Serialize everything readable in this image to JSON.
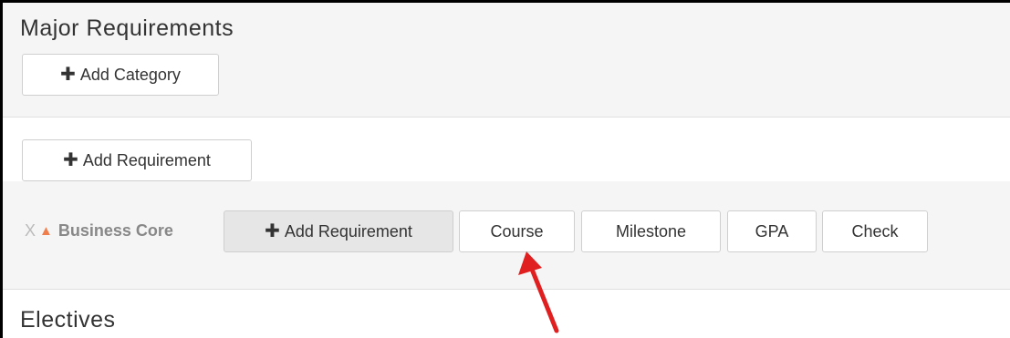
{
  "major": {
    "title": "Major Requirements",
    "add_category_label": "Add Category"
  },
  "requirements": {
    "add_requirement_label": "Add Requirement"
  },
  "business_core": {
    "remove_symbol": "X",
    "name": "Business Core",
    "add_requirement_label": "Add Requirement",
    "types": {
      "course": "Course",
      "milestone": "Milestone",
      "gpa": "GPA",
      "check": "Check"
    }
  },
  "electives": {
    "title": "Electives"
  },
  "colors": {
    "accent_triangle": "#f07e4d",
    "arrow": "#e02020"
  },
  "icons": [
    "plus-icon",
    "remove-icon",
    "warning-triangle-icon",
    "red-arrow-annotation"
  ]
}
